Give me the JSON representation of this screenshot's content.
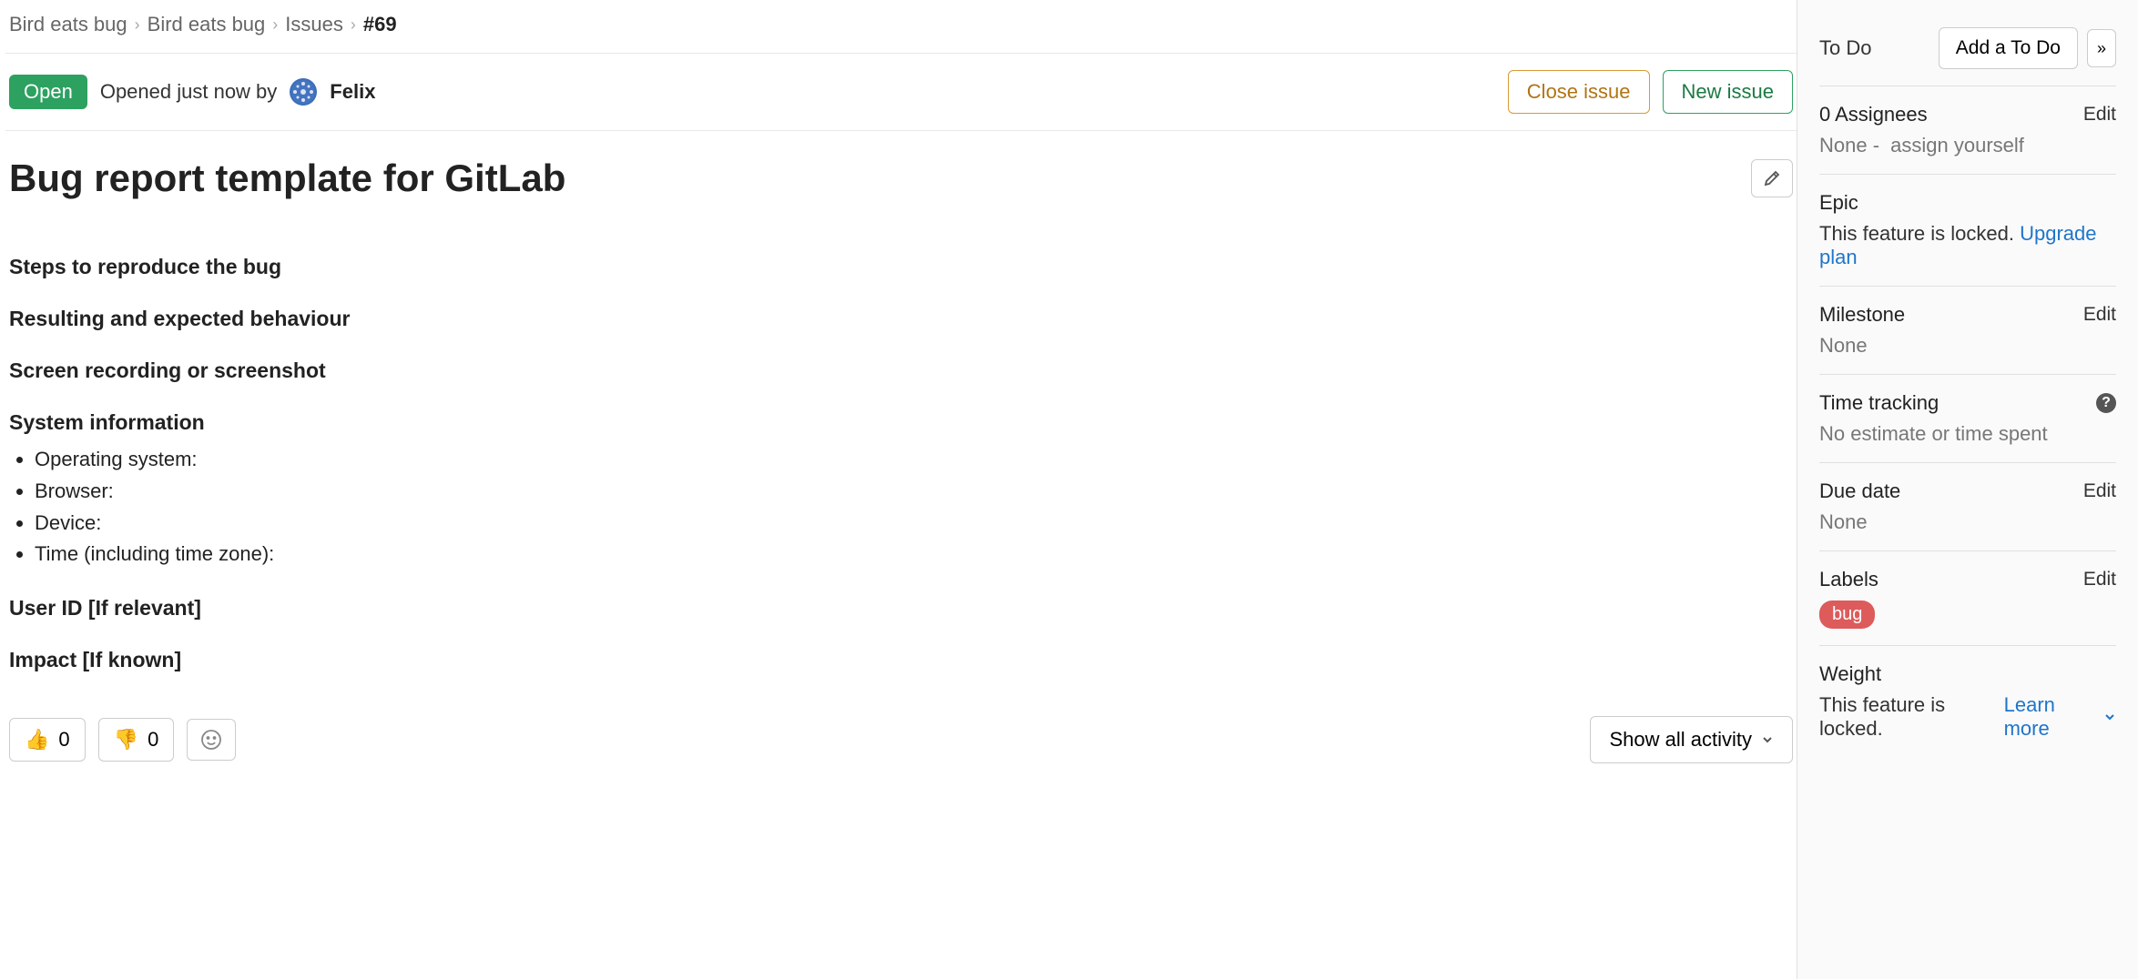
{
  "breadcrumb": {
    "group": "Bird eats bug",
    "project": "Bird eats bug",
    "section": "Issues",
    "current": "#69"
  },
  "status": {
    "badge": "Open",
    "opened_text": "Opened just now by",
    "author": "Felix"
  },
  "actions": {
    "close": "Close issue",
    "new": "New issue"
  },
  "title": "Bug report template for GitLab",
  "body": {
    "h1": "Steps to reproduce the bug",
    "h2": "Resulting and expected behaviour",
    "h3": "Screen recording or screenshot",
    "h4": "System information",
    "sys_items": [
      "Operating system:",
      "Browser:",
      "Device:",
      "Time (including time zone):"
    ],
    "h5": "User ID [If relevant]",
    "h6": "Impact [If known]"
  },
  "reactions": {
    "up": {
      "emoji": "👍",
      "count": "0"
    },
    "down": {
      "emoji": "👎",
      "count": "0"
    }
  },
  "activity_dd": "Show all activity",
  "sidebar": {
    "todo_label": "To Do",
    "todo_btn": "Add a To Do",
    "assignees": {
      "title": "0 Assignees",
      "edit": "Edit",
      "none": "None -",
      "assign": "assign yourself"
    },
    "epic": {
      "title": "Epic",
      "locked": "This feature is locked.",
      "upgrade": "Upgrade plan"
    },
    "milestone": {
      "title": "Milestone",
      "edit": "Edit",
      "value": "None"
    },
    "time": {
      "title": "Time tracking",
      "value": "No estimate or time spent"
    },
    "due": {
      "title": "Due date",
      "edit": "Edit",
      "value": "None"
    },
    "labels": {
      "title": "Labels",
      "edit": "Edit",
      "badge": "bug"
    },
    "weight": {
      "title": "Weight",
      "locked": "This feature is locked.",
      "learn": "Learn more"
    }
  }
}
